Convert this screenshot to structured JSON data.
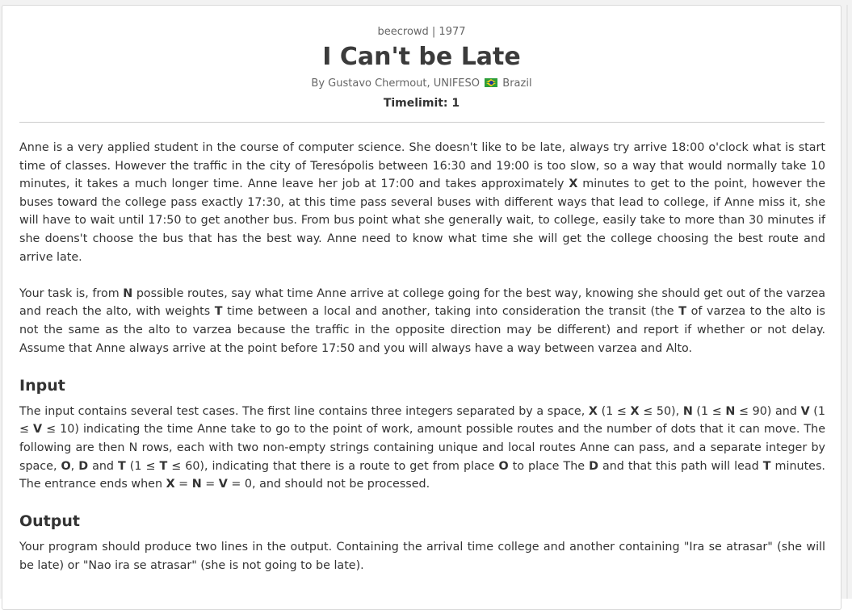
{
  "header": {
    "source": "beecrowd | 1977",
    "title": "I Can't be Late",
    "author_prefix": "By Gustavo Chermout, UNIFESO",
    "country": "Brazil",
    "timelimit": "Timelimit: 1"
  },
  "description": {
    "p1": "Anne is a very applied student in the course of computer science. She doesn't like to be late, always try arrive 18:00 o'clock what is start time of classes. However the traffic in the city of Teresópolis between 16:30 and 19:00 is too slow, so a way that would normally take 10 minutes, it takes a much longer time. Anne leave her job at 17:00 and takes approximately ",
    "p1_x": "X",
    "p1_rest": " minutes to get to the point, however the buses toward the college pass exactly 17:30, at this time pass several buses with different ways that lead to college, if Anne miss it, she will have to wait until 17:50 to get another bus. From bus point what she generally wait, to college, easily take to more than 30 minutes if she doens't choose the bus that has the best way. Anne need to know what time she will get the college choosing the best route and arrive late.",
    "p2_a": "Your task is, from ",
    "p2_n": "N",
    "p2_b": " possible routes, say what time Anne arrive at college going for the best way, knowing she should get out of the varzea and reach the alto, with weights ",
    "p2_t1": "T",
    "p2_c": " time between a local and another, taking into consideration the transit (the ",
    "p2_t2": "T",
    "p2_d": " of varzea to the alto is not the same as the alto to varzea because the traffic in the opposite direction may be different) and report if whether or not delay. Assume that Anne always arrive at the point before 17:50 and you will always have a way between varzea and Alto."
  },
  "input_section": {
    "heading": "Input",
    "a": "The input contains several test cases. The first line contains three integers separated by a space, ",
    "x1": "X",
    "b": " (1 ≤ ",
    "x2": "X",
    "c": " ≤ 50), ",
    "n1": "N",
    "d": " (1 ≤ ",
    "n2": "N",
    "e": " ≤ 90) and ",
    "v1": "V",
    "f": " (1 ≤ ",
    "v2": "V",
    "g": " ≤ 10) indicating the time Anne take to go to the point of work, amount possible routes and the number of dots that it can move. The following are then N rows, each with two non-empty strings containing unique and local routes Anne can pass, and a separate integer by space, ",
    "o1": "O",
    "h": ", ",
    "d1": "D",
    "i": " and ",
    "t1": "T",
    "j": " (1 ≤ ",
    "t2": "T",
    "k": " ≤ 60), indicating that there is a route to get from place ",
    "o2": "O",
    "l": " to place The ",
    "d2": "D",
    "m": " and that this path will lead ",
    "t3": "T",
    "n": " minutes. The entrance ends when ",
    "x3": "X",
    "o": " = ",
    "n3": "N",
    "p": " = ",
    "v3": "V",
    "q": " = 0, and should not be processed."
  },
  "output_section": {
    "heading": "Output",
    "text": "Your program should produce two lines in the output. Containing the arrival time college and another containing \"Ira se atrasar\" (she will be late) or \"Nao ira se atrasar\" (she is not going to be late)."
  },
  "colors": {
    "text": "#333333",
    "muted": "#666666",
    "divider": "#cccccc"
  },
  "icons": {
    "flag": "brazil-flag-icon"
  }
}
